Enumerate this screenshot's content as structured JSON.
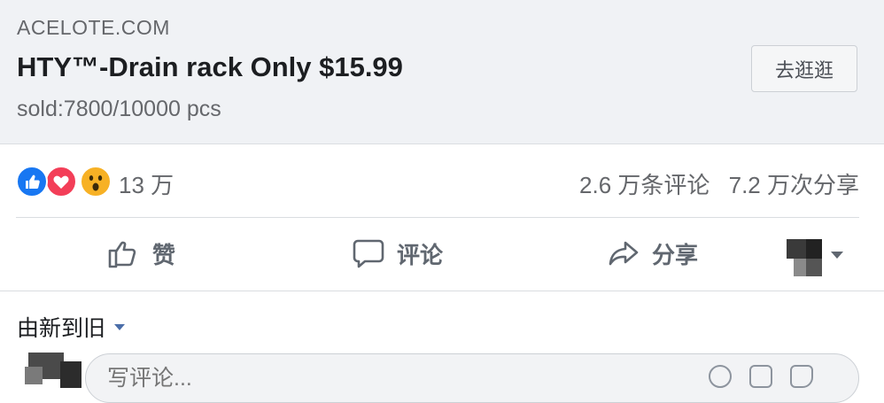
{
  "link_card": {
    "domain": "ACELOTE.COM",
    "title": "HTY™-Drain rack Only $15.99",
    "subtitle": "sold:7800/10000 pcs",
    "cta_label": "去逛逛"
  },
  "reactions": {
    "icons": [
      "like-icon",
      "love-icon",
      "wow-icon"
    ],
    "count": "13 万",
    "comments": "2.6 万条评论",
    "shares": "7.2 万次分享"
  },
  "actions": {
    "like_label": "赞",
    "comment_label": "评论",
    "share_label": "分享"
  },
  "sort": {
    "label": "由新到旧"
  },
  "composer": {
    "placeholder": "写评论..."
  },
  "colors": {
    "card_bg": "#f0f2f5",
    "like_blue": "#1877f2",
    "love_red": "#f33e58",
    "wow_yellow": "#f7b125",
    "meta_text": "#65676b"
  }
}
